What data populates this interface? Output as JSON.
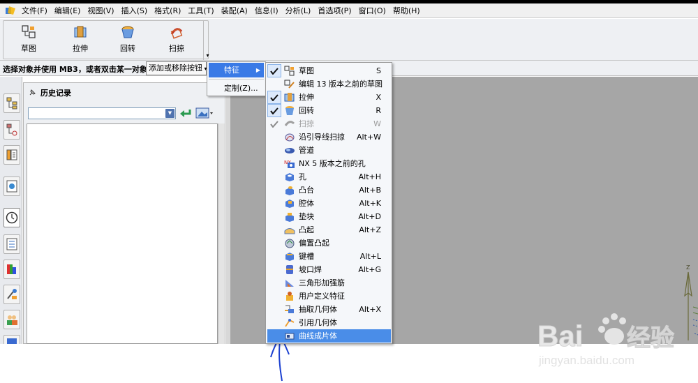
{
  "menubar": {
    "items": [
      "文件(F)",
      "编辑(E)",
      "视图(V)",
      "插入(S)",
      "格式(R)",
      "工具(T)",
      "装配(A)",
      "信息(I)",
      "分析(L)",
      "首选项(P)",
      "窗口(O)",
      "帮助(H)"
    ]
  },
  "toolbar": {
    "buttons": [
      "草图",
      "拉伸",
      "回转",
      "扫掠"
    ]
  },
  "selection_bar": {
    "prompt": "选择对象并使用 MB3，或者双击某一对象",
    "add_remove_button": "添加或移除按钮"
  },
  "history_panel": {
    "title": "历史记录"
  },
  "submenu": {
    "items": [
      "特征",
      "定制(Z)..."
    ]
  },
  "feature_menu": {
    "items": [
      {
        "label": "草图",
        "shortcut": "S"
      },
      {
        "label": "编辑 13 版本之前的草图",
        "shortcut": ""
      },
      {
        "label": "拉伸",
        "shortcut": "X"
      },
      {
        "label": "回转",
        "shortcut": "R"
      },
      {
        "label": "扫掠",
        "shortcut": "W"
      },
      {
        "label": "沿引导线扫掠",
        "shortcut": "Alt+W"
      },
      {
        "label": "管道",
        "shortcut": ""
      },
      {
        "label": "NX 5 版本之前的孔",
        "shortcut": ""
      },
      {
        "label": "孔",
        "shortcut": "Alt+H"
      },
      {
        "label": "凸台",
        "shortcut": "Alt+B"
      },
      {
        "label": "腔体",
        "shortcut": "Alt+K"
      },
      {
        "label": "垫块",
        "shortcut": "Alt+D"
      },
      {
        "label": "凸起",
        "shortcut": "Alt+Z"
      },
      {
        "label": "偏置凸起",
        "shortcut": ""
      },
      {
        "label": "键槽",
        "shortcut": "Alt+L"
      },
      {
        "label": "坡口焊",
        "shortcut": "Alt+G"
      },
      {
        "label": "三角形加强筋",
        "shortcut": ""
      },
      {
        "label": "用户定义特征",
        "shortcut": ""
      },
      {
        "label": "抽取几何体",
        "shortcut": "Alt+X"
      },
      {
        "label": "引用几何体",
        "shortcut": ""
      },
      {
        "label": "曲线成片体",
        "shortcut": ""
      }
    ]
  },
  "watermark": {
    "brand_left": "Bai",
    "brand_right": "经验",
    "url": "jingyan.baidu.com"
  },
  "axis": {
    "z_label": "Z"
  },
  "colors": {
    "highlight": "#4a8de8",
    "viewport": "#a6a6a6",
    "annotation": "#1a3fd0"
  }
}
